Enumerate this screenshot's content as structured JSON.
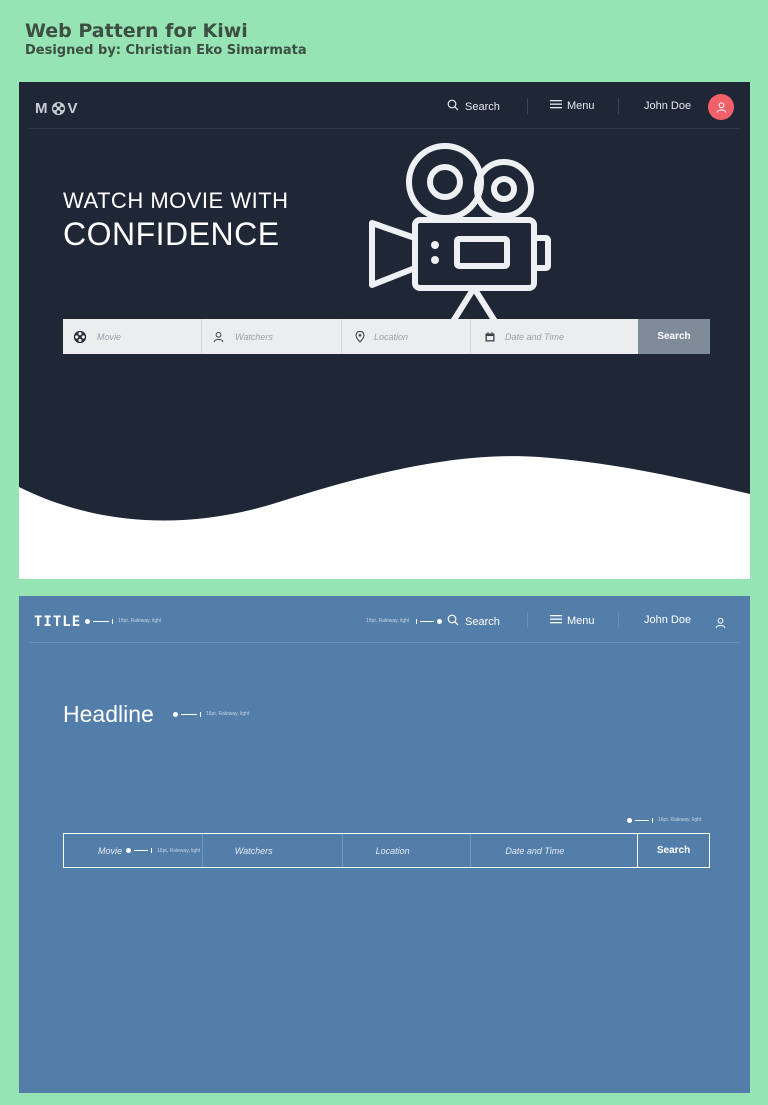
{
  "page": {
    "title": "Web Pattern for Kiwi",
    "subtitle": "Designed by: Christian Eko Simarmata"
  },
  "colors": {
    "background": "#96e4b4",
    "dark_panel": "#1f2736",
    "blue_panel": "#537ea9",
    "accent_avatar": "#f06068",
    "search_button": "#7f8b99"
  },
  "mockup": {
    "logo_left": "M",
    "logo_right": "V",
    "nav": {
      "search_label": "Search",
      "menu_label": "Menu",
      "user_name": "John Doe"
    },
    "hero": {
      "line1": "WATCH MOVIE WITH",
      "line2": "CONFIDENCE"
    },
    "searchbar": {
      "fields": [
        {
          "placeholder": "Movie",
          "icon": "film-reel-icon"
        },
        {
          "placeholder": "Watchers",
          "icon": "user-icon"
        },
        {
          "placeholder": "Location",
          "icon": "location-pin-icon"
        },
        {
          "placeholder": "Date and Time",
          "icon": "calendar-icon"
        }
      ],
      "button_label": "Search"
    }
  },
  "wireframe": {
    "title": "TITLE",
    "nav": {
      "search_label": "Search",
      "menu_label": "Menu",
      "user_name": "John Doe"
    },
    "headline": "Headline",
    "annotations": {
      "title_note": "16pt, Raleway, light",
      "search_note": "16pt, Raleway, light",
      "headline_note": "16pt, Raleway, light",
      "button_note": "16pt, Raleway, light",
      "movie_note": "16pt, Raleway, light"
    },
    "searchbar": {
      "fields": [
        "Movie",
        "Watchers",
        "Location",
        "Date and Time"
      ],
      "button_label": "Search"
    }
  }
}
